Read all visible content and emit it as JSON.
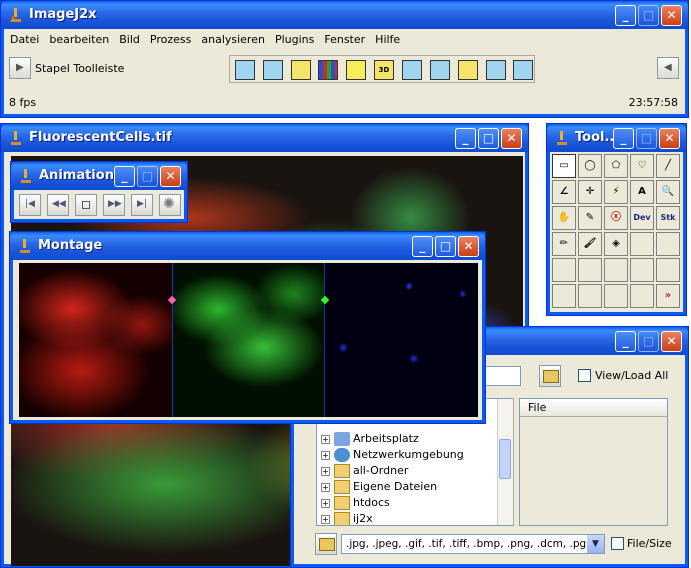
{
  "imagej": {
    "title": "ImageJ2x",
    "menu": [
      "Datei",
      "bearbeiten",
      "Bild",
      "Prozess",
      "analysieren",
      "Plugins",
      "Fenster",
      "Hilfe"
    ],
    "toolbar_label": "Stapel Toolleiste",
    "toolbar_icons": [
      "A",
      "A",
      "B",
      "grid",
      "note",
      "3D",
      "S",
      "C",
      "M",
      "T",
      "R"
    ],
    "status_left": "8 fps",
    "status_right": "23:57:58"
  },
  "fluorescent": {
    "title": "FluorescentCells.tif"
  },
  "animation": {
    "title": "Animation..."
  },
  "montage": {
    "title": "Montage"
  },
  "tools": {
    "title": "Tool...",
    "rows": [
      [
        "rect",
        "oval",
        "poly",
        "heart",
        "line"
      ],
      [
        "angle",
        "crosshair",
        "wand",
        "A",
        "zoom"
      ],
      [
        "hand",
        "dropper",
        "X",
        "Dev",
        "Stk"
      ],
      [
        "pencil",
        "brush",
        "bucket",
        "",
        ""
      ],
      [
        "",
        "",
        "",
        "",
        ""
      ],
      [
        "",
        "",
        "",
        "",
        ">>"
      ]
    ]
  },
  "browser": {
    "view_load_all": "View/Load All",
    "file_header": "File",
    "tree": [
      "Arbeitsplatz",
      "Netzwerkumgebung",
      "all-Ordner",
      "Eigene Dateien",
      "htdocs",
      "ij2x"
    ],
    "filter": ".jpg, .jpeg, .gif, .tif, .tiff, .bmp, .png, .dcm, .pgm",
    "file_size": "File/Size"
  },
  "colors": {
    "xp_blue": "#0A5CF0",
    "face": "#ECE9D8",
    "close_red": "#C93E17"
  }
}
